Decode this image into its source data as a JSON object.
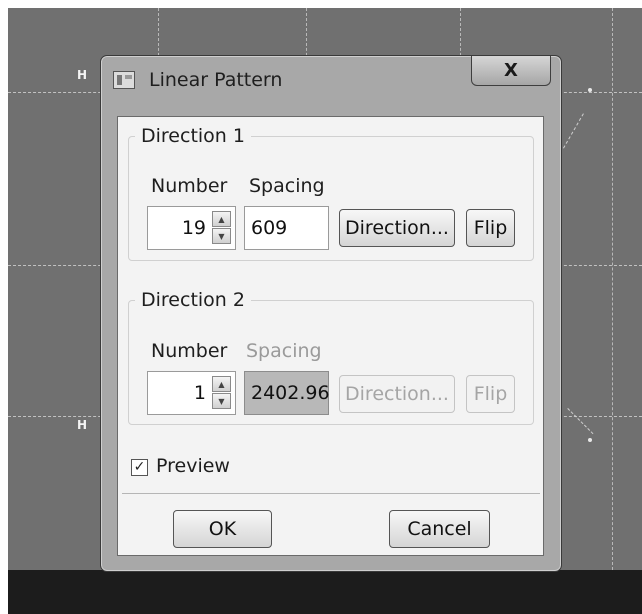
{
  "canvas": {
    "markers": [
      "H",
      "H"
    ]
  },
  "dialog": {
    "title": "Linear Pattern",
    "close_symbol": "X",
    "direction1": {
      "legend": "Direction 1",
      "number_label": "Number",
      "spacing_label": "Spacing",
      "number_value": "19",
      "spacing_value": "609",
      "direction_button": "Direction...",
      "flip_button": "Flip"
    },
    "direction2": {
      "legend": "Direction 2",
      "number_label": "Number",
      "spacing_label": "Spacing",
      "number_value": "1",
      "spacing_value": "2402.96",
      "direction_button": "Direction...",
      "flip_button": "Flip"
    },
    "preview": {
      "label": "Preview",
      "checked": true,
      "check_mark": "✓"
    },
    "ok_button": "OK",
    "cancel_button": "Cancel"
  },
  "icons": {
    "spin_up": "▲",
    "spin_down": "▼"
  }
}
